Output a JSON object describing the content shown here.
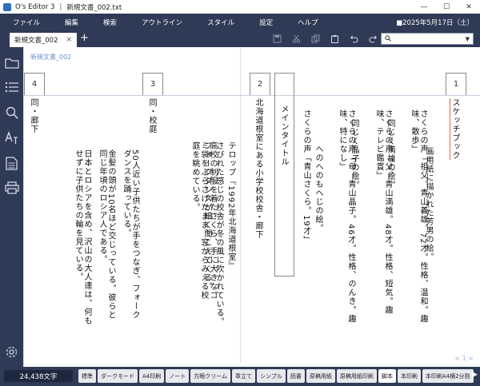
{
  "window": {
    "app_title": "O's Editor 3",
    "separator": "|",
    "file_title": "新規文書_002.txt",
    "minimize": "—",
    "maximize": "☐",
    "close": "✕"
  },
  "menu": {
    "items": [
      "ファイル",
      "編集",
      "検索",
      "アウトライン",
      "スタイル",
      "設定",
      "ヘルプ"
    ],
    "date": "■2025年5月17日（土）"
  },
  "tabs": {
    "active_tab": "新規文書_002",
    "close_glyph": "×",
    "add_glyph": "+"
  },
  "toolbar": {
    "icons": [
      "save-icon",
      "cut-icon",
      "copy-icon",
      "paste-icon",
      "undo-icon",
      "redo-icon",
      "pen-icon"
    ]
  },
  "search": {
    "glyph": "🔍",
    "value": "",
    "dropdown_glyph": "▼"
  },
  "sidebar": {
    "icons": [
      "folder-icon",
      "outline-list-icon",
      "search-icon",
      "font-style-icon",
      "document-icon",
      "print-icon",
      "settings-gear-icon"
    ]
  },
  "document": {
    "file_label": "新規文書_002",
    "pages": [
      {
        "number": "1",
        "title": "スケッチブック",
        "lines": [
          "画用紙に描かれた芳男の絵。",
          "さくらの声「祖父。青山義雄。72才。性格、温和。趣味、散歩」",
          "同じく満雄の絵。",
          "さくらの声「父。青山満雄。48才。性格、短気。趣味、テレビ鑑賞」",
          "同じく晶子の絵。",
          "さくらの声「母。青山晶子。46才。性格、のんき。趣味、特になし」",
          "へのへのもへじの絵。",
          "さくらの声「青山さくら。19才」"
        ]
      },
      {
        "number": "2",
        "title": "北海道根室にある小学校校舎・廊下",
        "lines": []
      },
      {
        "number": "main",
        "title": "メインタイトル",
        "lines": [
          "テロップ『1992年北海道根室』",
          "さびれた感じの校舎が冬の風に吹かれている。",
          "フォークダンスが細く聞こえてくる。",
          "高校の制服を着たさくら、手に大きなゴミ袋をぶらさげたまま、窓からみえる校庭を眺めている。"
        ]
      },
      {
        "number": "3",
        "title": "同・校庭",
        "lines": [
          "50人近い子供たちが手をつなぎ、フォークダンスを踊っている。",
          "金髪の頭が10名ほど交じっている。彼らと同じ年頃のロシア人である。",
          "日本とロシアを含め、沢山の大人達は、何もせずに子供たちの輪を見ている。"
        ]
      },
      {
        "number": "4",
        "title": "同・廊下",
        "lines": []
      }
    ],
    "page_indicator": "< 1 >"
  },
  "status": {
    "char_count": "24,438文字",
    "modes": [
      "標準",
      "ダークモード",
      "A4印刷",
      "ノート",
      "方眼クリーム",
      "章立て",
      "シンプル",
      "読書",
      "原稿用紙",
      "原稿用紙印刷",
      "脚本",
      "本印刷",
      "本印刷A4横2分割"
    ],
    "active_mode": "脚本",
    "arrow": "▶"
  },
  "colors": {
    "chrome": "#2f3a56",
    "accent_text": "#6e8fc8",
    "cursor_underline": "#e26c2e"
  }
}
